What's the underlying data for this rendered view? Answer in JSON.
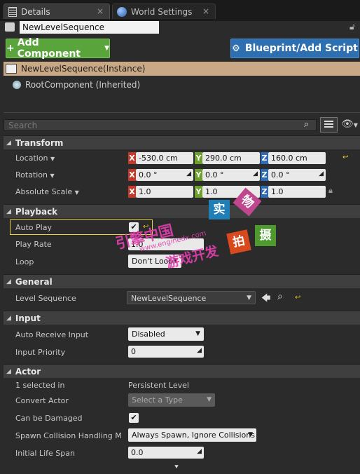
{
  "tabs": [
    {
      "label": "Details",
      "close": "×"
    },
    {
      "label": "World Settings",
      "close": "×"
    }
  ],
  "object_name": "NewLevelSequence",
  "buttons": {
    "add_component": "Add Component",
    "blueprint": "Blueprint/Add Script"
  },
  "components": {
    "instance": "NewLevelSequence(Instance)",
    "root": "RootComponent (Inherited)"
  },
  "search": {
    "placeholder": "Search"
  },
  "sections": {
    "transform": {
      "title": "Transform",
      "location": {
        "label": "Location",
        "x": "-530.0 cm",
        "y": "290.0 cm",
        "z": "160.0 cm"
      },
      "rotation": {
        "label": "Rotation",
        "x": "0.0 °",
        "y": "0.0 °",
        "z": "0.0 °"
      },
      "scale": {
        "label": "Absolute Scale",
        "x": "1.0",
        "y": "1.0",
        "z": "1.0"
      }
    },
    "playback": {
      "title": "Playback",
      "auto_play": {
        "label": "Auto Play",
        "checked": true
      },
      "play_rate": {
        "label": "Play Rate",
        "value": "1.0"
      },
      "loop": {
        "label": "Loop",
        "value": "Don't Loop"
      }
    },
    "general": {
      "title": "General",
      "level_sequence": {
        "label": "Level Sequence",
        "value": "NewLevelSequence"
      }
    },
    "input": {
      "title": "Input",
      "auto_receive": {
        "label": "Auto Receive Input",
        "value": "Disabled"
      },
      "priority": {
        "label": "Input Priority",
        "value": "0"
      }
    },
    "actor": {
      "title": "Actor",
      "selected": {
        "label": "1 selected in",
        "value": "Persistent Level"
      },
      "convert": {
        "label": "Convert Actor",
        "value": "Select a Type"
      },
      "damaged": {
        "label": "Can be Damaged",
        "checked": true
      },
      "spawn": {
        "label": "Spawn Collision Handling M",
        "value": "Always Spawn, Ignore Collisions"
      },
      "lifespan": {
        "label": "Initial Life Span",
        "value": "0.0"
      }
    }
  },
  "watermark": {
    "cn1": "引擎中国",
    "url": "www.enginedx.com",
    "cn2": "游戏开发",
    "tags": [
      "实",
      "物",
      "拍",
      "摄"
    ]
  },
  "axis_letters": {
    "x": "X",
    "y": "Y",
    "z": "Z"
  }
}
